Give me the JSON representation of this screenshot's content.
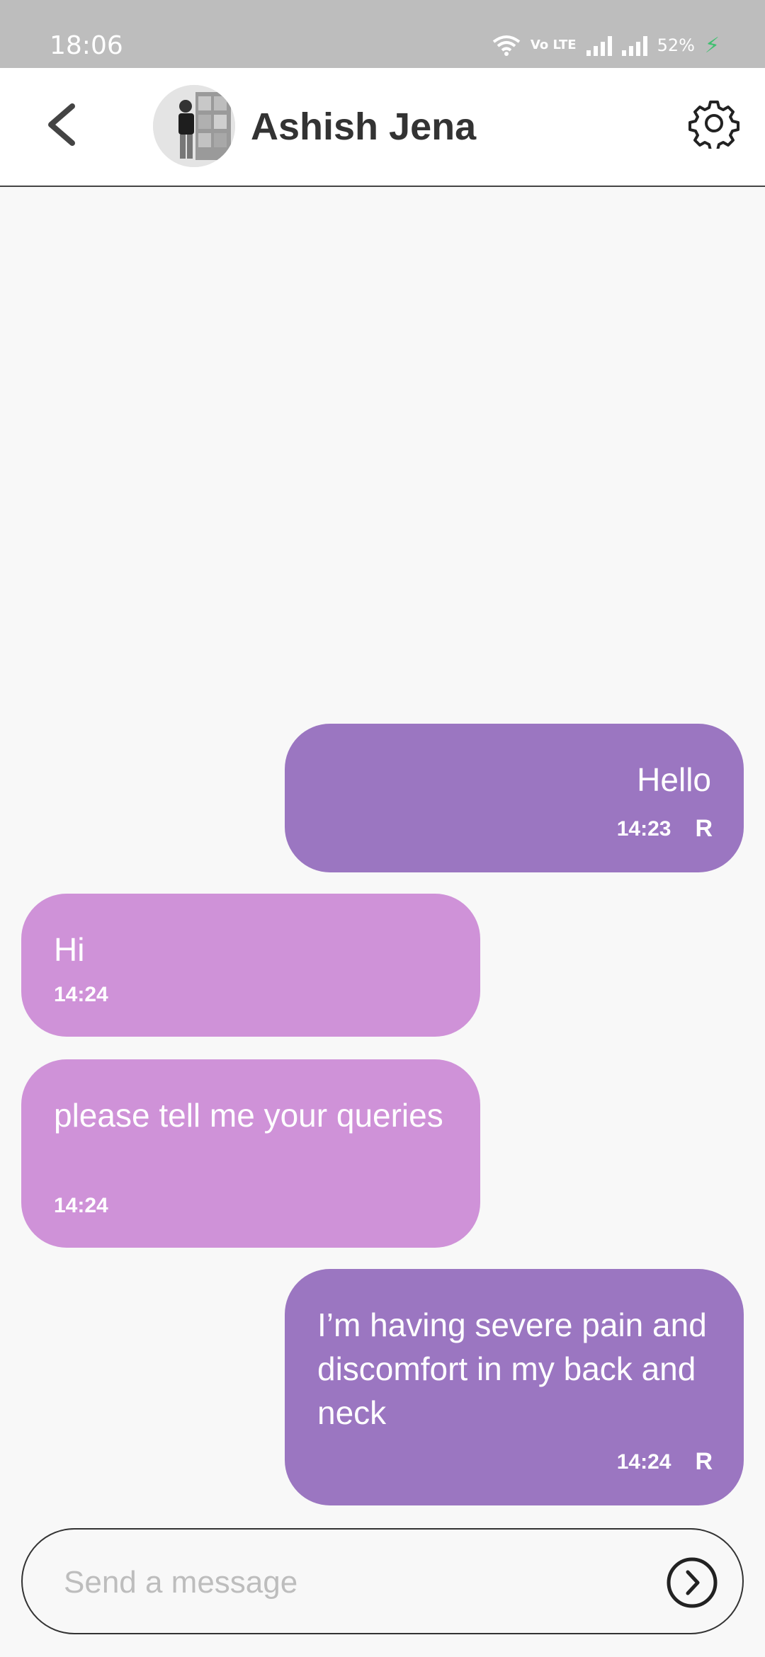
{
  "status_bar": {
    "time": "18:06",
    "network": "Vo LTE",
    "battery": "52%"
  },
  "header": {
    "contact_name": "Ashish Jena",
    "back_icon": "chevron-left-icon",
    "settings_icon": "gear-icon"
  },
  "messages": [
    {
      "direction": "out",
      "text": "Hello",
      "time": "14:23",
      "receipt": "R"
    },
    {
      "direction": "in",
      "text": "Hi",
      "time": "14:24"
    },
    {
      "direction": "in",
      "text": "please tell me your queries",
      "time": "14:24"
    },
    {
      "direction": "out",
      "text": "I’m having severe pain and discomfort in my back and neck",
      "time": "14:24",
      "receipt": "R"
    }
  ],
  "composer": {
    "placeholder": "Send a message",
    "value": "",
    "send_icon": "send-circle-arrow-icon"
  },
  "colors": {
    "outgoing_bubble": "#9b76c1",
    "incoming_bubble": "#cf92d8",
    "status_bar": "#bdbdbd",
    "background": "#f8f8f8"
  }
}
